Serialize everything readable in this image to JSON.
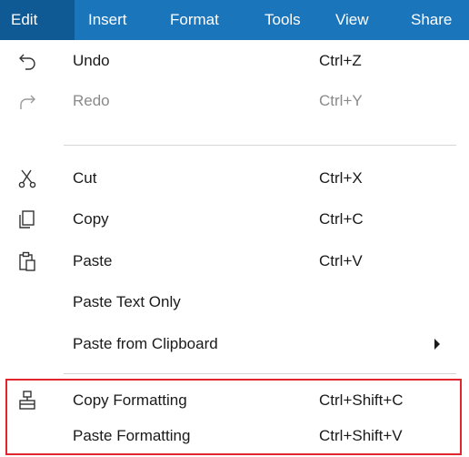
{
  "menubar": {
    "items": [
      {
        "label": "Edit"
      },
      {
        "label": "Insert"
      },
      {
        "label": "Format"
      },
      {
        "label": "Tools"
      },
      {
        "label": "View"
      },
      {
        "label": "Share"
      }
    ]
  },
  "edit_menu": {
    "undo": {
      "label": "Undo",
      "shortcut": "Ctrl+Z",
      "icon": "undo-icon"
    },
    "redo": {
      "label": "Redo",
      "shortcut": "Ctrl+Y",
      "icon": "redo-icon",
      "disabled": true
    },
    "cut": {
      "label": "Cut",
      "shortcut": "Ctrl+X",
      "icon": "scissors-icon"
    },
    "copy": {
      "label": "Copy",
      "shortcut": "Ctrl+C",
      "icon": "copy-icon"
    },
    "paste": {
      "label": "Paste",
      "shortcut": "Ctrl+V",
      "icon": "clipboard-icon"
    },
    "paste_text_only": {
      "label": "Paste Text Only"
    },
    "paste_from_clipboard": {
      "label": "Paste from Clipboard",
      "has_submenu": true
    },
    "copy_formatting": {
      "label": "Copy Formatting",
      "shortcut": "Ctrl+Shift+C",
      "icon": "format-painter-icon"
    },
    "paste_formatting": {
      "label": "Paste Formatting",
      "shortcut": "Ctrl+Shift+V"
    }
  },
  "colors": {
    "menubar_bg": "#1b75bb",
    "active_menu_bg": "#0f5a94",
    "highlight_border": "#e0262c"
  }
}
